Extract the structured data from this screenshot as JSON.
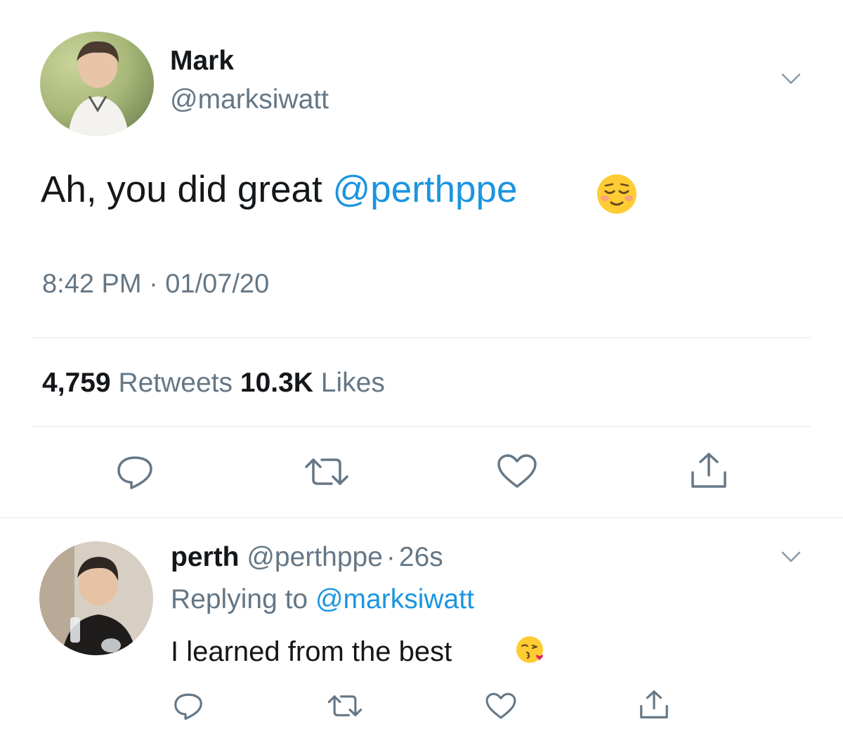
{
  "main_tweet": {
    "author_name": "Mark",
    "handle": "@marksiwatt",
    "text_prefix": "Ah, you did great ",
    "mention": "@perthppe",
    "emoji": "smiling-face-emoji",
    "timestamp": "8:42 PM · 01/07/20",
    "retweet_count": "4,759",
    "retweet_label": "Retweets",
    "like_count": "10.3K",
    "like_label": "Likes",
    "actions": [
      "reply-icon",
      "retweet-icon",
      "like-icon",
      "share-icon"
    ]
  },
  "reply_tweet": {
    "author_name": "perth",
    "handle": "@perthppe",
    "separator": "·",
    "age": "26s",
    "replying_label": "Replying to ",
    "replying_to": "@marksiwatt",
    "text": "I learned from the best ",
    "emoji": "face-blowing-kiss-emoji",
    "actions": [
      "reply-icon",
      "retweet-icon",
      "like-icon",
      "share-icon"
    ]
  },
  "colors": {
    "text": "#14171a",
    "muted": "#657786",
    "link": "#1b95e0",
    "divider": "#e1e8ed"
  }
}
